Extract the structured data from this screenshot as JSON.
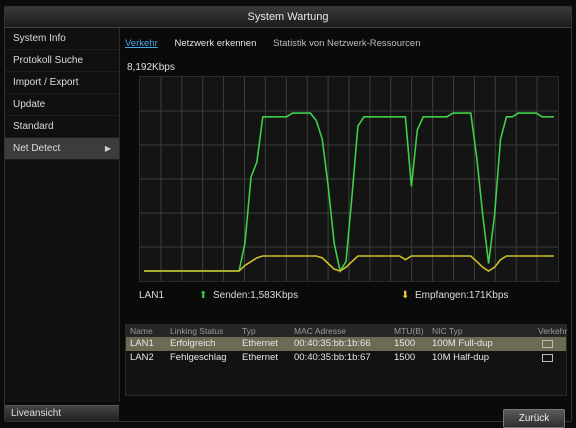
{
  "window": {
    "title": "System Wartung"
  },
  "sidebar": {
    "items": [
      {
        "label": "System Info"
      },
      {
        "label": "Protokoll Suche"
      },
      {
        "label": "Import / Export"
      },
      {
        "label": "Update"
      },
      {
        "label": "Standard"
      },
      {
        "label": "Net Detect",
        "active": true,
        "arrow": "▶"
      }
    ],
    "live_view_label": "Liveansicht"
  },
  "tabs": [
    {
      "label": "Verkehr",
      "active": true
    },
    {
      "label": "Netzwerk erkennen"
    },
    {
      "label": "Statistik von Netzwerk-Ressourcen"
    }
  ],
  "graph": {
    "y_max_label": "8,192Kbps",
    "colors": {
      "send": "#3fce4a",
      "receive": "#cfc02a",
      "grid": "#3e3e3e"
    }
  },
  "chart_data": {
    "type": "line",
    "y_max_label": "8,192Kbps",
    "series": [
      {
        "name": "Senden",
        "color": "#3fce4a",
        "values": [
          0,
          0,
          0,
          0,
          0,
          0,
          0,
          0,
          0,
          0,
          0,
          0,
          0,
          0,
          0,
          0,
          0,
          0.15,
          0.5,
          0.58,
          0.82,
          0.82,
          0.82,
          0.82,
          0.82,
          0.84,
          0.84,
          0.84,
          0.84,
          0.8,
          0.7,
          0.45,
          0.15,
          0.0,
          0.05,
          0.4,
          0.77,
          0.82,
          0.82,
          0.82,
          0.82,
          0.82,
          0.82,
          0.82,
          0.82,
          0.45,
          0.75,
          0.82,
          0.82,
          0.82,
          0.82,
          0.82,
          0.84,
          0.84,
          0.84,
          0.84,
          0.6,
          0.3,
          0.04,
          0.3,
          0.7,
          0.82,
          0.82,
          0.84,
          0.84,
          0.84,
          0.84,
          0.82,
          0.82,
          0.82
        ]
      },
      {
        "name": "Empfangen",
        "color": "#cfc02a",
        "values": [
          0,
          0,
          0,
          0,
          0,
          0,
          0,
          0,
          0,
          0,
          0,
          0,
          0,
          0,
          0,
          0,
          0,
          0.03,
          0.05,
          0.07,
          0.08,
          0.08,
          0.08,
          0.08,
          0.08,
          0.08,
          0.08,
          0.08,
          0.08,
          0.08,
          0.07,
          0.04,
          0.01,
          0.0,
          0.02,
          0.05,
          0.08,
          0.08,
          0.08,
          0.08,
          0.08,
          0.08,
          0.08,
          0.08,
          0.06,
          0.08,
          0.08,
          0.08,
          0.08,
          0.08,
          0.08,
          0.08,
          0.08,
          0.08,
          0.08,
          0.08,
          0.05,
          0.02,
          0.0,
          0.02,
          0.06,
          0.08,
          0.08,
          0.08,
          0.08,
          0.08,
          0.08,
          0.08,
          0.08,
          0.08
        ]
      }
    ]
  },
  "legend": {
    "interface": "LAN1",
    "send_label": "Senden:1,583Kbps",
    "receive_label": "Empfangen:171Kbps",
    "send_icon": "up-arrow",
    "receive_icon": "down-arrow"
  },
  "nic_table": {
    "headers": [
      "Name",
      "Linking Status",
      "Typ",
      "MAC Adresse",
      "MTU(B)",
      "NIC Typ",
      "Verkehr"
    ],
    "rows": [
      {
        "name": "LAN1",
        "status": "Erfolgreich",
        "type": "Ethernet",
        "mac": "00:40:35:bb:1b:66",
        "mtu": "1500",
        "nic": "100M Full-dup",
        "selected": true
      },
      {
        "name": "LAN2",
        "status": "Fehlgeschlag",
        "type": "Ethernet",
        "mac": "00:40:35:bb:1b:67",
        "mtu": "1500",
        "nic": "10M Half-dup",
        "selected": false
      }
    ]
  },
  "buttons": {
    "back": "Zurück"
  }
}
